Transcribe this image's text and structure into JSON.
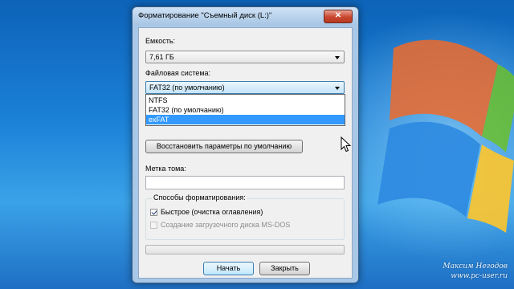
{
  "window": {
    "title": "Форматирование \"Съемный диск (L:)\"",
    "close_icon": "✕"
  },
  "capacity": {
    "label": "Емкость:",
    "value": "7,61 ГБ"
  },
  "filesystem": {
    "label": "Файловая система:",
    "value": "FAT32 (по умолчанию)",
    "options": [
      "NTFS",
      "FAT32 (по умолчанию)",
      "exFAT"
    ],
    "highlighted_option": "exFAT"
  },
  "restore_button": {
    "label": "Восстановить параметры по умолчанию"
  },
  "volume_label": {
    "label": "Метка тома:",
    "value": ""
  },
  "format_options": {
    "title": "Способы форматирования:",
    "quick": {
      "label": "Быстрое (очистка оглавления)",
      "checked": true
    },
    "msdos": {
      "label": "Создание загрузочного диска MS-DOS",
      "checked": false,
      "enabled": false
    }
  },
  "progress": {
    "value": 0
  },
  "buttons": {
    "start": "Начать",
    "close": "Закрыть"
  },
  "watermark": {
    "name": "Максим Негодов",
    "site": "www.pc-user.ru"
  },
  "colors": {
    "selection": "#3399ff",
    "close_button": "#c9472f",
    "desktop": "#1a7fd6"
  }
}
